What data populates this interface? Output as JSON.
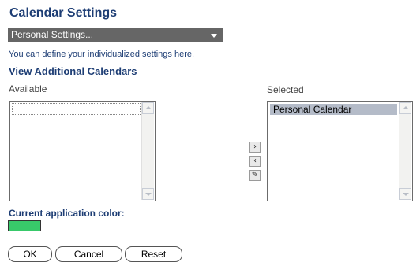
{
  "title": "Calendar Settings",
  "settings_dropdown": {
    "value": "Personal Settings..."
  },
  "description": "You can define your individualized settings here.",
  "view_additional_title": "View Additional Calendars",
  "available": {
    "label": "Available",
    "items": []
  },
  "selected": {
    "label": "Selected",
    "items": [
      "Personal Calendar"
    ]
  },
  "move_buttons": {
    "add_icon": "chevron-right-icon",
    "remove_icon": "chevron-left-icon",
    "edit_icon": "edit-pen-icon",
    "add_glyph": "›",
    "remove_glyph": "‹",
    "edit_glyph": "✎"
  },
  "color_section": {
    "label": "Current application color:",
    "color": "#38c96a"
  },
  "buttons": {
    "ok": "OK",
    "cancel": "Cancel",
    "reset": "Reset"
  },
  "colors": {
    "heading": "#1d3d74",
    "dropdown_bg": "#666666",
    "selected_item_bg": "#b4bbc8"
  }
}
